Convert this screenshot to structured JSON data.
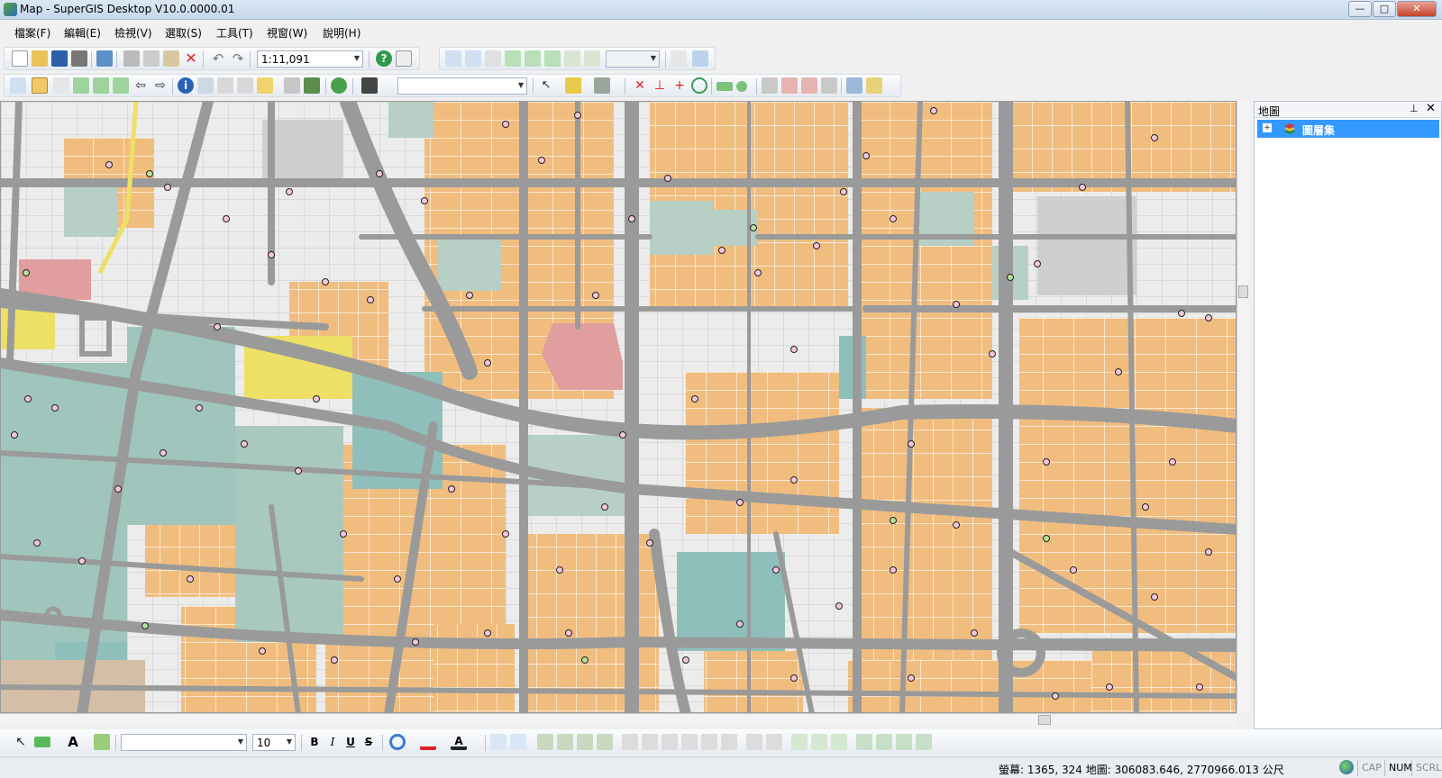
{
  "window": {
    "title": "Map - SuperGIS Desktop V10.0.0000.01",
    "min": "—",
    "max": "□",
    "close": "✕"
  },
  "menu": [
    "檔案(F)",
    "編輯(E)",
    "檢視(V)",
    "選取(S)",
    "工具(T)",
    "視窗(W)",
    "說明(H)"
  ],
  "toolbar": {
    "scale": "1:11,091",
    "layer_combo": "",
    "font_combo": "",
    "font_size": "10"
  },
  "draw_toolbar": {
    "bold": "B",
    "italic": "I",
    "underline": "U",
    "strike": "S"
  },
  "panel": {
    "title": "地圖",
    "pin": "⊥",
    "close": "✕",
    "layer_expand": "+",
    "layer_label": "圖層集"
  },
  "status": {
    "coords": "螢幕: 1365, 324  地圖: 306083.646, 2770966.013 公尺",
    "cap": "CAP",
    "num": "NUM",
    "scrl": "SCRL"
  },
  "colors": {
    "parcel": "#f0bd7f",
    "park": "#9fc5bc",
    "road": "#9a9a9a",
    "poi": "#d9a0c0",
    "yellow": "#ede064",
    "pink": "#e19e9e",
    "selection": "#3399ff"
  }
}
